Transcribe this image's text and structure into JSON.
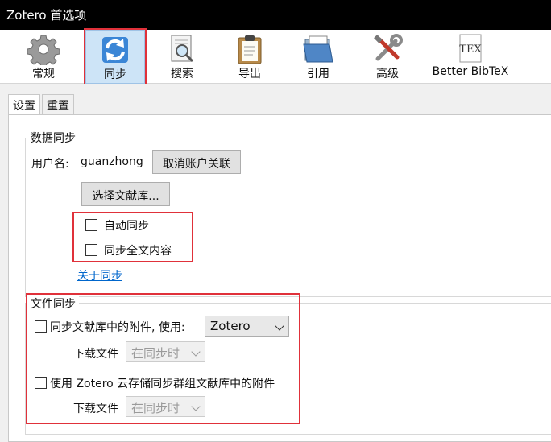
{
  "window": {
    "title": "Zotero 首选项"
  },
  "toolbar": {
    "items": [
      {
        "label": "常规",
        "icon": "gear-icon"
      },
      {
        "label": "同步",
        "icon": "sync-icon",
        "selected": true
      },
      {
        "label": "搜索",
        "icon": "search-icon"
      },
      {
        "label": "导出",
        "icon": "clipboard-icon"
      },
      {
        "label": "引用",
        "icon": "folder-icon"
      },
      {
        "label": "高级",
        "icon": "tools-icon"
      },
      {
        "label": "Better BibTeX",
        "icon": "tex-icon"
      }
    ]
  },
  "subtabs": {
    "settings": "设置",
    "reset": "重置",
    "active": "设置"
  },
  "data_sync": {
    "title": "数据同步",
    "username_label": "用户名:",
    "username_value": "guanzhong",
    "unlink_button": "取消账户关联",
    "choose_library_button": "选择文献库...",
    "auto_sync_label": "自动同步",
    "auto_sync_checked": false,
    "fulltext_sync_label": "同步全文内容",
    "fulltext_sync_checked": false,
    "about_link": "关于同步"
  },
  "file_sync": {
    "title": "文件同步",
    "sync_attachments_label": "同步文献库中的附件, 使用:",
    "sync_attachments_checked": false,
    "sync_method_value": "Zotero",
    "download_label_1": "下载文件",
    "download_value_1": "在同步时",
    "group_sync_label": "使用 Zotero 云存储同步群组文献库中的附件",
    "group_sync_checked": false,
    "download_label_2": "下载文件",
    "download_value_2": "在同步时"
  },
  "colors": {
    "highlight_red": "#e0313a",
    "link_blue": "#0066cc",
    "selected_tab_bg": "#cde4f7"
  }
}
